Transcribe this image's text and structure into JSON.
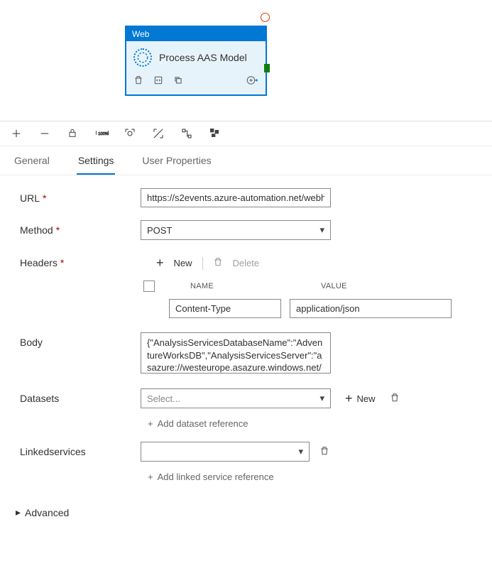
{
  "activity": {
    "header": "Web",
    "title": "Process AAS Model"
  },
  "tabs": {
    "general": "General",
    "settings": "Settings",
    "userprops": "User Properties"
  },
  "form": {
    "url_label": "URL",
    "url_value": "https://s2events.azure-automation.net/webh",
    "method_label": "Method",
    "method_value": "POST",
    "headers_label": "Headers",
    "headers_new": "New",
    "headers_delete": "Delete",
    "headers_col_name": "NAME",
    "headers_col_value": "VALUE",
    "header_name": "Content-Type",
    "header_value": "application/json",
    "body_label": "Body",
    "body_value": "{\"AnalysisServicesDatabaseName\":\"AdventureWorksDB\",\"AnalysisServicesServer\":\"asazure://westeurope.asazure.windows.net/MyAn",
    "datasets_label": "Datasets",
    "datasets_placeholder": "Select...",
    "datasets_new": "New",
    "datasets_addref": "Add dataset reference",
    "linked_label": "Linkedservices",
    "linked_addref": "Add linked service reference",
    "advanced": "Advanced"
  }
}
